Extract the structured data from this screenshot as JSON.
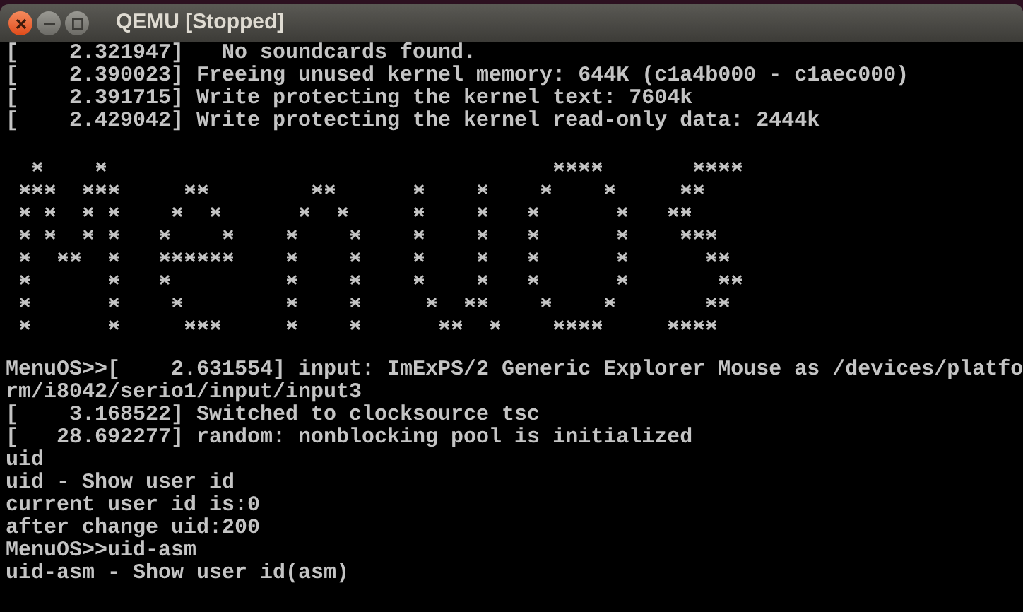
{
  "window": {
    "title": "QEMU [Stopped]"
  },
  "boot_log": [
    "[    2.321947]   No soundcards found.",
    "[    2.390023] Freeing unused kernel memory: 644K (c1a4b000 - c1aec000)",
    "[    2.391715] Write protecting the kernel text: 7604k",
    "[    2.429042] Write protecting the kernel read-only data: 2444k"
  ],
  "console": [
    "MenuOS>>[    2.631554] input: ImExPS/2 Generic Explorer Mouse as /devices/platfo",
    "rm/i8042/serio1/input/input3",
    "[    3.168522] Switched to clocksource tsc",
    "[   28.692277] random: nonblocking pool is initialized",
    "uid",
    "uid - Show user id",
    "current user id is:0",
    "after change uid:200",
    "MenuOS>>uid-asm",
    "uid-asm - Show user id(asm)"
  ]
}
